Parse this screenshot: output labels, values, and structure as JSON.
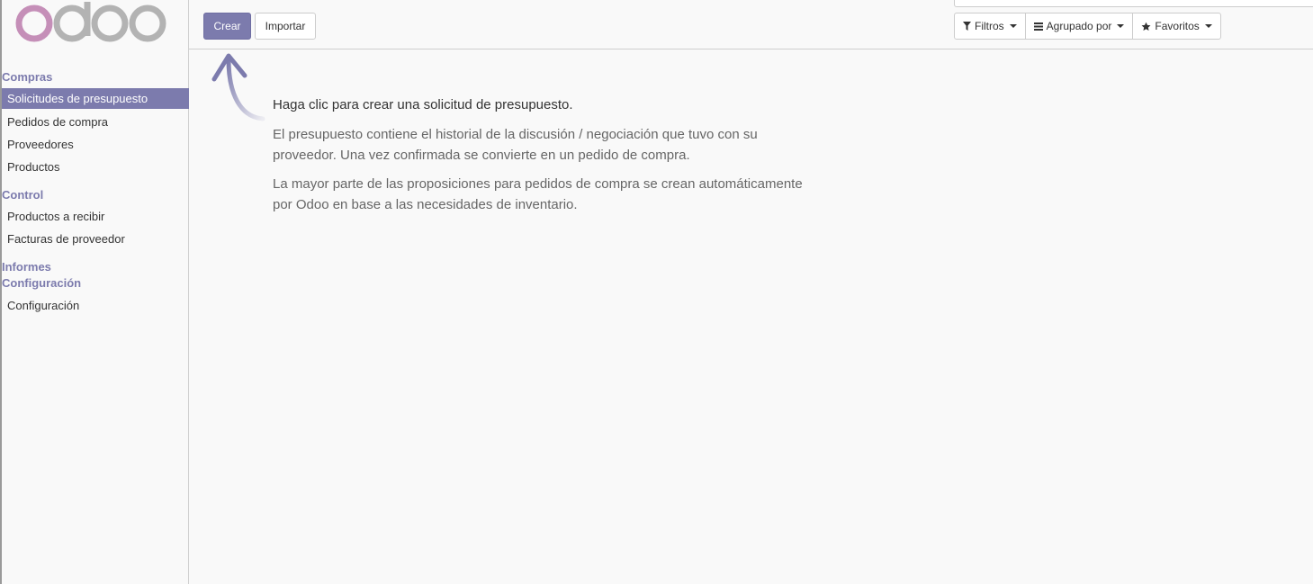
{
  "app": {
    "logo_text": "odoo"
  },
  "sidebar": {
    "sections": [
      {
        "label": "Compras"
      },
      {
        "label": "Control"
      },
      {
        "label": "Informes"
      },
      {
        "label": "Configuración"
      }
    ],
    "items": [
      {
        "label": "Solicitudes de presupuesto",
        "active": true
      },
      {
        "label": "Pedidos de compra"
      },
      {
        "label": "Proveedores"
      },
      {
        "label": "Productos"
      },
      {
        "label": "Productos a recibir"
      },
      {
        "label": "Facturas de proveedor"
      },
      {
        "label": "Configuración"
      }
    ]
  },
  "toolbar": {
    "create_label": "Crear",
    "import_label": "Importar",
    "filters_label": "Filtros",
    "groupby_label": "Agrupado por",
    "favorites_label": "Favoritos"
  },
  "help": {
    "title": "Haga clic para crear una solicitud de presupuesto.",
    "paragraph1": "El presupuesto contiene el historial de la discusión / negociación que tuvo con su proveedor. Una vez confirmada se convierte en un pedido de compra.",
    "paragraph2": "La mayor parte de las proposiciones para pedidos de compra se crean automáticamente por Odoo en base a las necesidades de inventario."
  },
  "colors": {
    "accent": "#7c7bad",
    "logo_pink": "#c58fb8",
    "logo_gray": "#b3b3b3"
  },
  "icons": {
    "filters": "filter-icon",
    "groupby": "bars-icon",
    "favorites": "star-icon"
  }
}
